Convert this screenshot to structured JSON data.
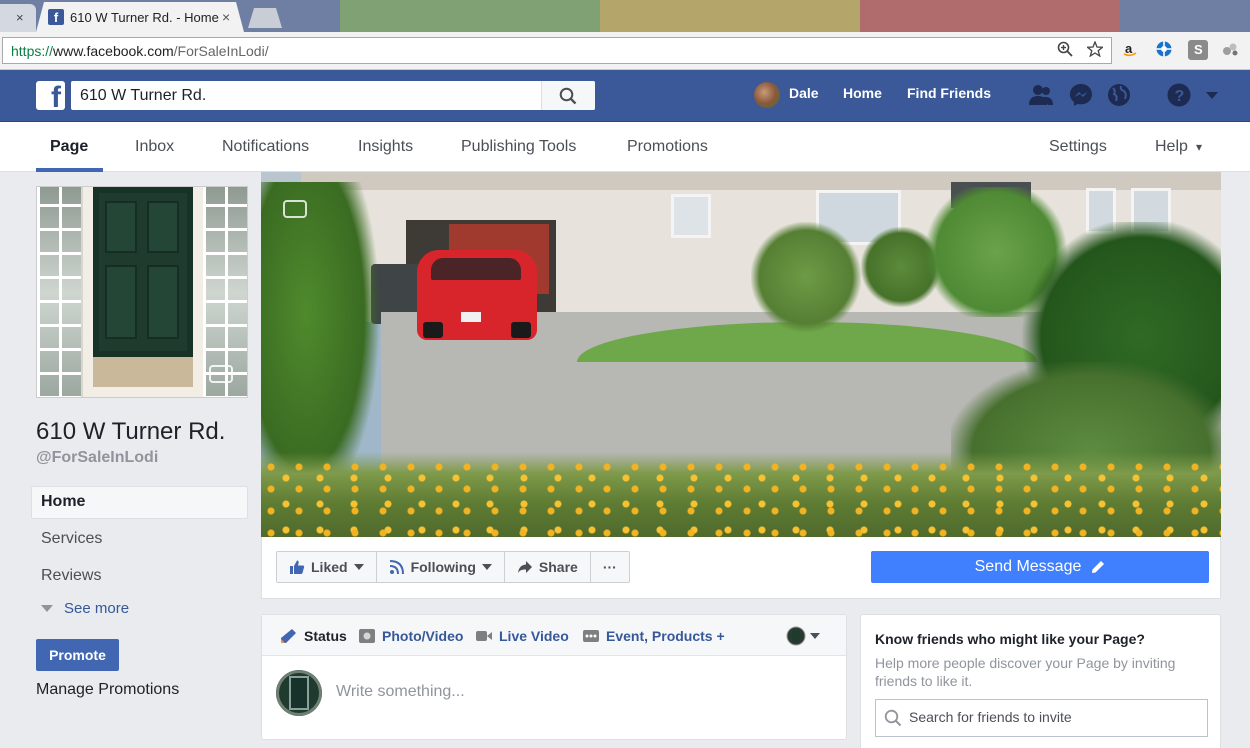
{
  "browser": {
    "prev_tab_close": "×",
    "tab_title": "610 W Turner Rd. - Home",
    "tab_close": "×",
    "url_scheme": "https://",
    "url_host": "www.facebook.com",
    "url_path": "/ForSaleInLodi/"
  },
  "fb": {
    "logo": "f",
    "search_value": "610 W Turner Rd.",
    "user_name": "Dale",
    "nav_home": "Home",
    "nav_find_friends": "Find Friends"
  },
  "page_tabs": {
    "page": "Page",
    "inbox": "Inbox",
    "notifications": "Notifications",
    "insights": "Insights",
    "publishing_tools": "Publishing Tools",
    "promotions": "Promotions",
    "settings": "Settings",
    "help": "Help",
    "help_caret": "▾"
  },
  "sidebar": {
    "page_name": "610 W Turner Rd.",
    "page_handle": "@ForSaleInLodi",
    "nav_home": "Home",
    "nav_services": "Services",
    "nav_reviews": "Reviews",
    "see_more": "See more",
    "promote": "Promote",
    "manage_promotions": "Manage Promotions"
  },
  "actions": {
    "liked": "Liked",
    "following": "Following",
    "share": "Share",
    "more": "···",
    "send_message": "Send Message"
  },
  "composer": {
    "tab_status": "Status",
    "tab_photo_video": "Photo/Video",
    "tab_live_video": "Live Video",
    "tab_event_products": "Event, Products +",
    "placeholder": "Write something..."
  },
  "invite": {
    "title": "Know friends who might like your Page?",
    "description": "Help more people discover your Page by inviting friends to like it.",
    "search_placeholder": "Search for friends to invite"
  },
  "colors": {
    "fb_blue": "#3b5998",
    "button_blue": "#4267b2",
    "send_message_blue": "#4080ff",
    "link_blue": "#365899"
  }
}
